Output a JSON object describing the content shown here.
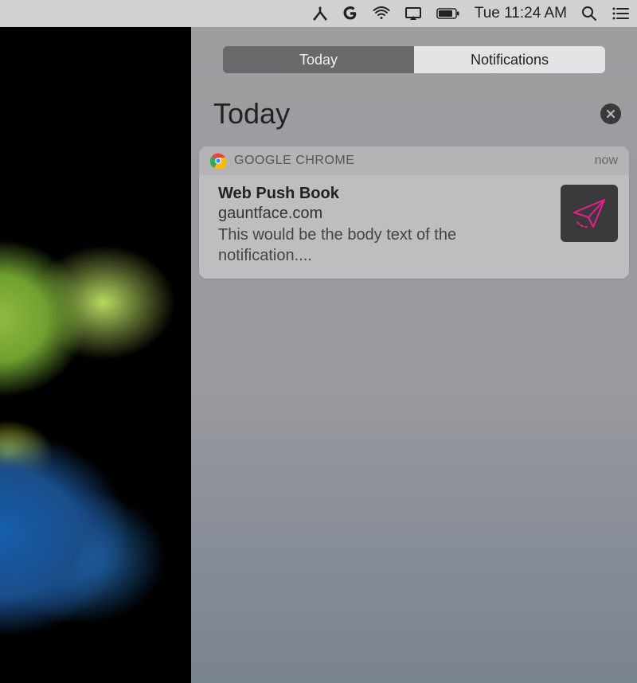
{
  "menubar": {
    "datetime": "Tue 11:24 AM"
  },
  "notification_center": {
    "tabs": {
      "today": "Today",
      "notifications": "Notifications"
    },
    "title": "Today"
  },
  "notification": {
    "app_name": "GOOGLE CHROME",
    "timestamp": "now",
    "title": "Web Push Book",
    "domain": "gauntface.com",
    "body": "This would be the body text of the notification...."
  }
}
